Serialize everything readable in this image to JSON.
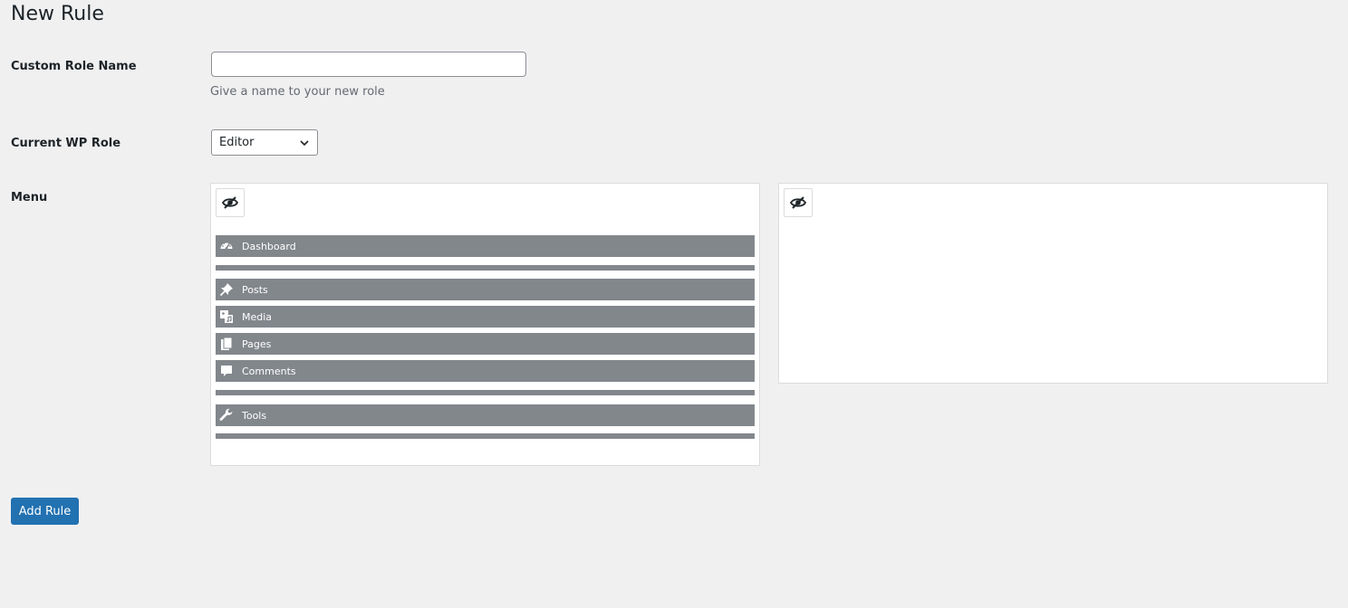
{
  "page": {
    "title": "New Rule"
  },
  "form": {
    "role_name": {
      "label": "Custom Role Name",
      "value": "",
      "placeholder": "",
      "help": "Give a name to your new role"
    },
    "wp_role": {
      "label": "Current WP Role",
      "selected": "Editor"
    },
    "menu": {
      "label": "Menu",
      "left_items": [
        {
          "type": "item",
          "label": "Dashboard",
          "icon": "dashboard-icon"
        },
        {
          "type": "separator"
        },
        {
          "type": "item",
          "label": "Posts",
          "icon": "pin-icon"
        },
        {
          "type": "item",
          "label": "Media",
          "icon": "media-icon"
        },
        {
          "type": "item",
          "label": "Pages",
          "icon": "pages-icon"
        },
        {
          "type": "item",
          "label": "Comments",
          "icon": "comment-icon"
        },
        {
          "type": "separator"
        },
        {
          "type": "item",
          "label": "Tools",
          "icon": "wrench-icon"
        },
        {
          "type": "separator"
        }
      ],
      "right_items": []
    }
  },
  "actions": {
    "add_rule_label": "Add Rule"
  },
  "colors": {
    "background": "#f0f0f1",
    "menu_item_bg": "#82878c",
    "primary_button": "#2271b1"
  }
}
